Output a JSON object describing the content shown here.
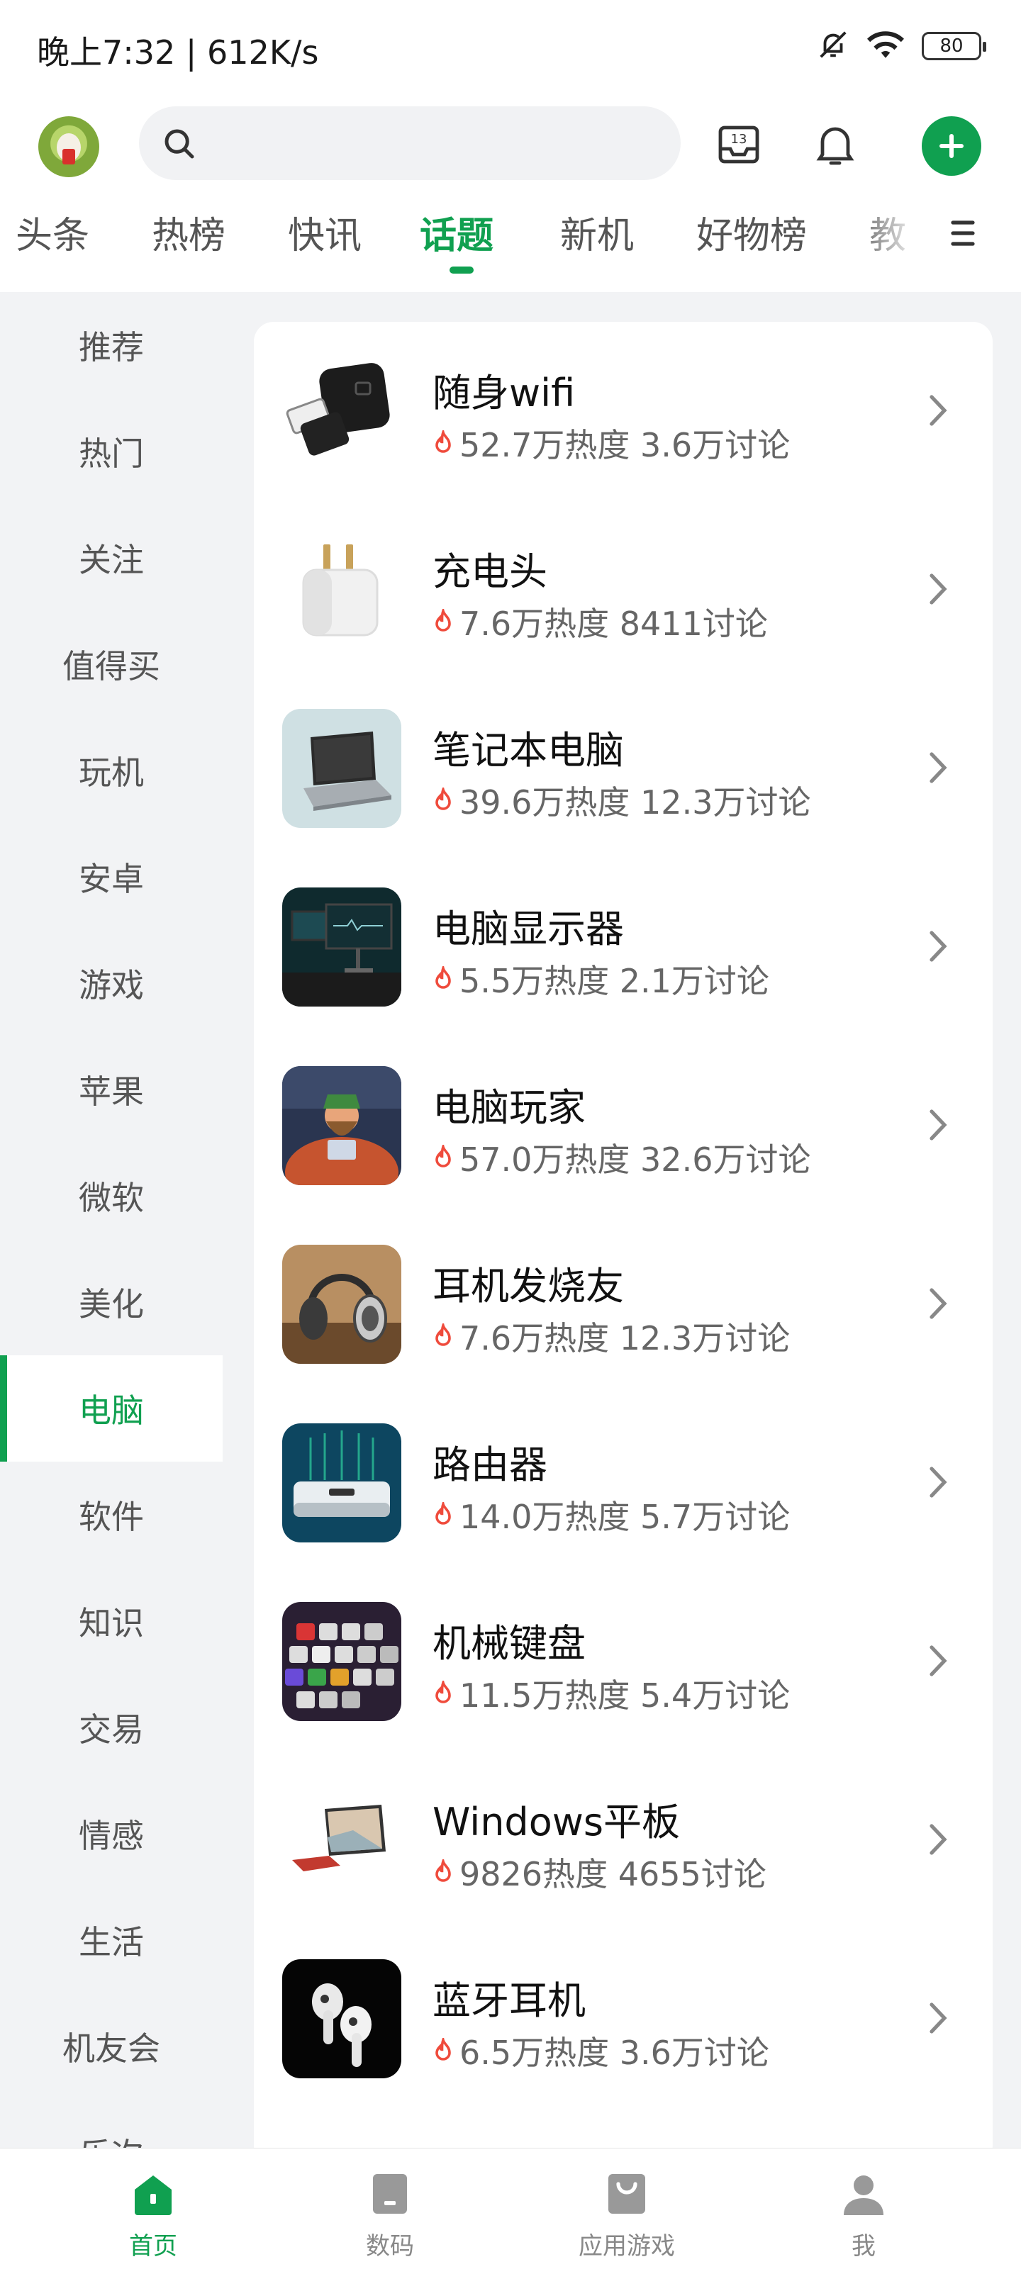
{
  "status_bar": {
    "time": "晚上7:32 | 612K/s",
    "battery": "80"
  },
  "header": {
    "notification_badge_count": "13",
    "icons": [
      "avatar",
      "search-icon",
      "inbox-icon",
      "bell-icon",
      "plus-icon"
    ]
  },
  "tabs": [
    {
      "label": "头条"
    },
    {
      "label": "热榜"
    },
    {
      "label": "快讯"
    },
    {
      "label": "话题",
      "active": true
    },
    {
      "label": "新机"
    },
    {
      "label": "好物榜"
    },
    {
      "label": "教"
    }
  ],
  "sidebar": {
    "items": [
      {
        "label": "推荐"
      },
      {
        "label": "热门"
      },
      {
        "label": "关注"
      },
      {
        "label": "值得买"
      },
      {
        "label": "玩机"
      },
      {
        "label": "安卓"
      },
      {
        "label": "游戏"
      },
      {
        "label": "苹果"
      },
      {
        "label": "微软"
      },
      {
        "label": "美化"
      },
      {
        "label": "电脑",
        "active": true
      },
      {
        "label": "软件"
      },
      {
        "label": "知识"
      },
      {
        "label": "交易"
      },
      {
        "label": "情感"
      },
      {
        "label": "生活"
      },
      {
        "label": "机友会"
      },
      {
        "label": "乐次"
      }
    ]
  },
  "topics": [
    {
      "name": "随身wifi",
      "stats": "52.7万热度 3.6万讨论",
      "thumb": "usb-wifi"
    },
    {
      "name": "充电头",
      "stats": "7.6万热度 8411讨论",
      "thumb": "charger"
    },
    {
      "name": "笔记本电脑",
      "stats": "39.6万热度 12.3万讨论",
      "thumb": "laptop"
    },
    {
      "name": "电脑显示器",
      "stats": "5.5万热度 2.1万讨论",
      "thumb": "monitor"
    },
    {
      "name": "电脑玩家",
      "stats": "57.0万热度 32.6万讨论",
      "thumb": "gamer"
    },
    {
      "name": "耳机发烧友",
      "stats": "7.6万热度 12.3万讨论",
      "thumb": "headphones"
    },
    {
      "name": "路由器",
      "stats": "14.0万热度 5.7万讨论",
      "thumb": "router"
    },
    {
      "name": "机械键盘",
      "stats": "11.5万热度 5.4万讨论",
      "thumb": "keyboard"
    },
    {
      "name": "Windows平板",
      "stats": "9826热度 4655讨论",
      "thumb": "tablet"
    },
    {
      "name": "蓝牙耳机",
      "stats": "6.5万热度 3.6万讨论",
      "thumb": "earbuds"
    }
  ],
  "bottom_nav": [
    {
      "label": "首页",
      "active": true
    },
    {
      "label": "数码"
    },
    {
      "label": "应用游戏"
    },
    {
      "label": "我"
    }
  ],
  "colors": {
    "accent": "#10a050",
    "flame": "#ef4b3c",
    "panel_bg": "#f2f3f5"
  }
}
